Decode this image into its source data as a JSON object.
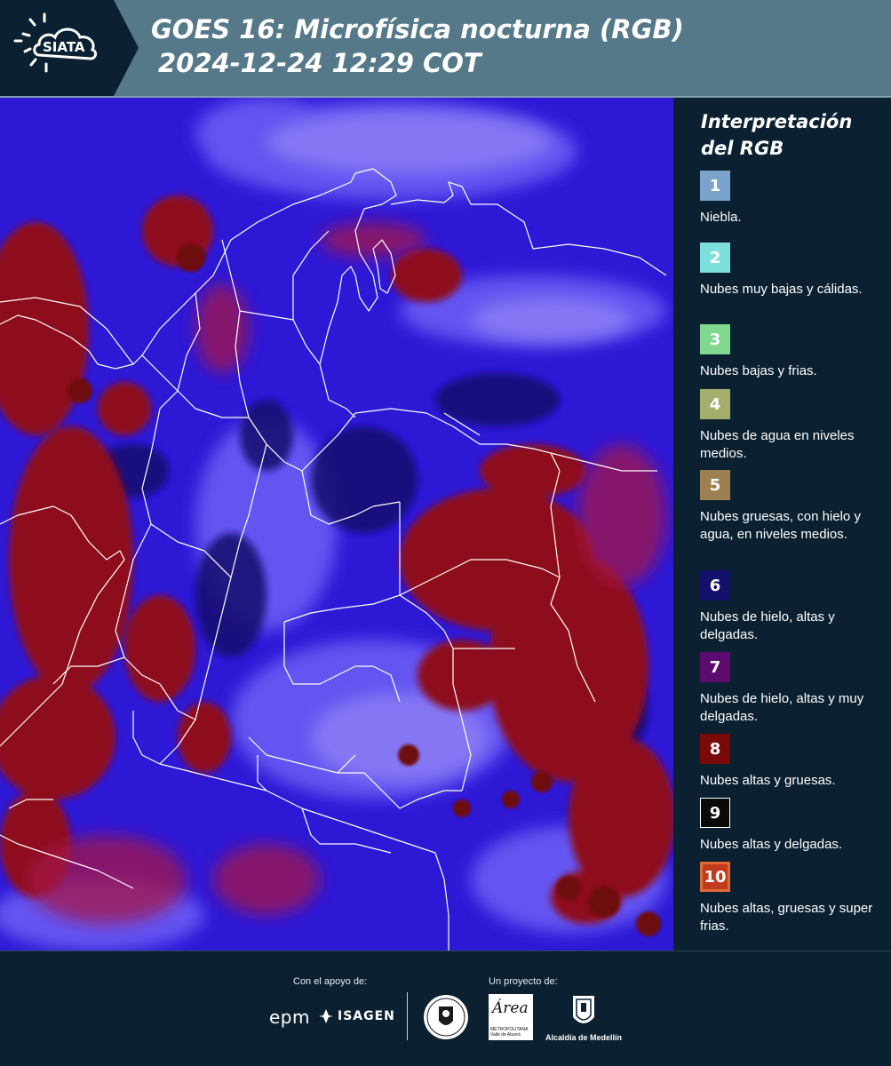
{
  "header": {
    "logo_text": "SIATA",
    "title_line1": "GOES 16: Microfísica nocturna (RGB)",
    "title_line2": "2024-12-24 12:29 COT",
    "background": "#56798a"
  },
  "map": {
    "product": "GOES 16 Nighttime Microphysics RGB",
    "dominant_colors": [
      "#2b16d8",
      "#4a3cf0",
      "#8a1020",
      "#1a0a60"
    ],
    "border_color": "#ffffff"
  },
  "legend": {
    "title": "Interpretación del RGB",
    "items": [
      {
        "number": "1",
        "color": "#7aa4cc",
        "label": "Niebla."
      },
      {
        "number": "2",
        "color": "#7ee0dc",
        "label": "Nubes muy bajas y cálidas."
      },
      {
        "number": "3",
        "color": "#7fd88e",
        "label": "Nubes bajas y frias."
      },
      {
        "number": "4",
        "color": "#a3ad6c",
        "label": "Nubes de agua en niveles medios."
      },
      {
        "number": "5",
        "color": "#9c8050",
        "label": "Nubes gruesas, con hielo y agua, en niveles medios."
      },
      {
        "number": "6",
        "color": "#14106e",
        "label": "Nubes de hielo, altas y delgadas."
      },
      {
        "number": "7",
        "color": "#5c0c6e",
        "label": "Nubes de hielo, altas y muy delgadas."
      },
      {
        "number": "8",
        "color": "#7a0a0a",
        "label": "Nubes altas y gruesas."
      },
      {
        "number": "9",
        "color": "#0a0a0a",
        "label": "Nubes altas y delgadas."
      },
      {
        "number": "10",
        "color": "#c03a1c",
        "label": "Nubes altas, gruesas y super frias."
      }
    ]
  },
  "footer": {
    "support_label": "Con el apoyo de:",
    "project_label": "Un proyecto de:",
    "sponsors": [
      "epm",
      "ISAGEN"
    ],
    "area_word": "Área",
    "area_sub": "METROPOLITANA Valle de Aburrá",
    "alcaldia": "Alcaldía de Medellín"
  }
}
